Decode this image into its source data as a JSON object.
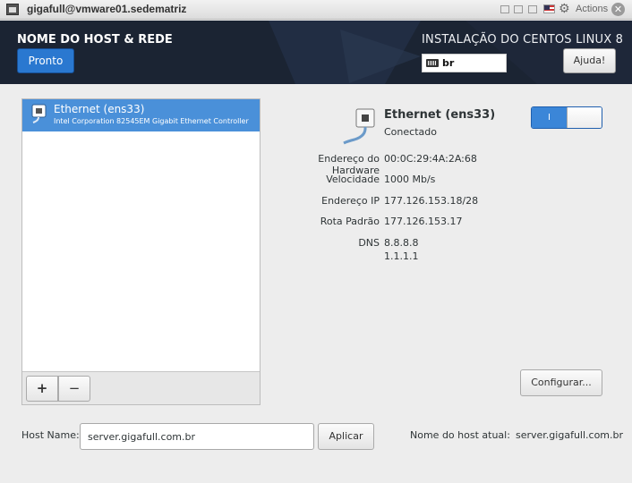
{
  "window": {
    "title": "gigafull@vmware01.sedematriz",
    "actions_label": "Actions"
  },
  "header": {
    "page_title": "NOME DO HOST & REDE",
    "done_button": "Pronto",
    "install_title": "INSTALAÇÃO DO CENTOS LINUX 8",
    "keyboard_layout": "br",
    "help_button": "Ajuda!"
  },
  "devices": [
    {
      "name": "Ethernet (ens33)",
      "description": "Intel Corporation 82545EM Gigabit Ethernet Controller"
    }
  ],
  "device_toolbar": {
    "add": "+",
    "remove": "−"
  },
  "detail": {
    "name": "Ethernet (ens33)",
    "status": "Conectado",
    "toggle_label": "I",
    "toggle_on": true,
    "hardware_address_label": "Endereço do Hardware",
    "hardware_address": "00:0C:29:4A:2A:68",
    "speed_label": "Velocidade",
    "speed": "1000 Mb/s",
    "ip_label": "Endereço IP",
    "ip": "177.126.153.18/28",
    "gateway_label": "Rota Padrão",
    "gateway": "177.126.153.17",
    "dns_label": "DNS",
    "dns_primary": "8.8.8.8",
    "dns_secondary": "1.1.1.1",
    "configure_button": "Configurar..."
  },
  "hostname": {
    "label": "Host Name:",
    "value": "server.gigafull.com.br",
    "apply_button": "Aplicar",
    "current_label": "Nome do host atual:",
    "current_value": "server.gigafull.com.br"
  },
  "colors": {
    "header_bg": "#1b2433",
    "accent_blue": "#2a78d0",
    "selected_row": "#4a90d9",
    "page_bg": "#ededed"
  }
}
